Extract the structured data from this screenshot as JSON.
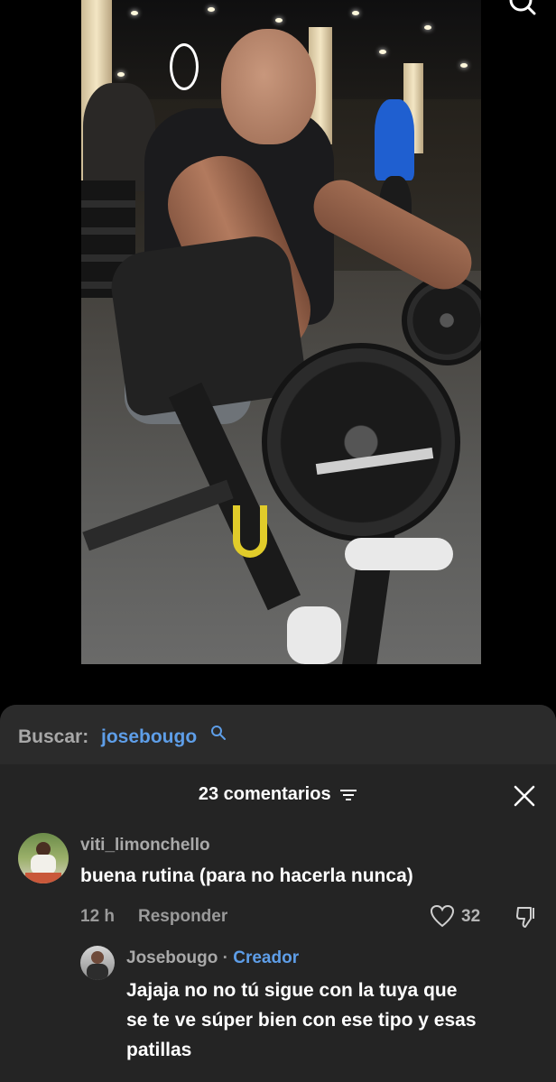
{
  "search": {
    "prefix": "Buscar:",
    "term": "josebougo"
  },
  "comments_panel": {
    "count_label": "23 comentarios"
  },
  "comments": [
    {
      "username": "viti_limonchello",
      "text": "buena rutina (para no hacerla nunca)",
      "time": "12 h",
      "reply_label": "Responder",
      "likes": "32"
    }
  ],
  "reply": {
    "username": "Josebougo",
    "separator": "·",
    "creator_label": "Creador",
    "text_lines": [
      "Jajaja no no tú sigue con la tuya que",
      "se te ve súper bien con ese tipo y esas",
      "patillas"
    ]
  },
  "colors": {
    "accent_blue": "#5e9ee8",
    "sheet_bg": "#242424"
  }
}
